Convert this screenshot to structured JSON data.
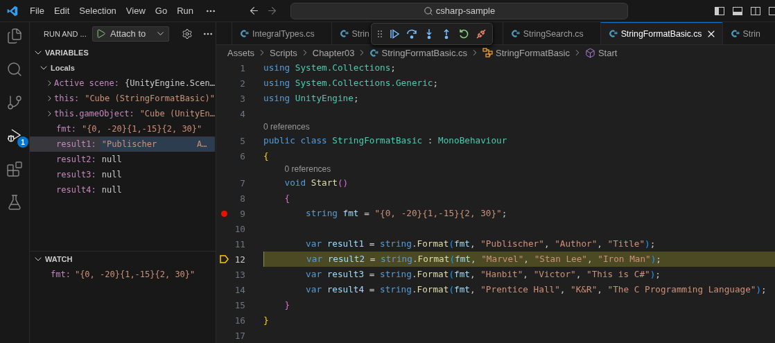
{
  "title_bar": {
    "menus": [
      "File",
      "Edit",
      "Selection",
      "View",
      "Go",
      "Run"
    ],
    "search": "csharp-sample"
  },
  "activity_bar": [
    {
      "kind": "explorer",
      "selected": false
    },
    {
      "kind": "search",
      "selected": false
    },
    {
      "kind": "source_control",
      "selected": false
    },
    {
      "kind": "debug",
      "selected": true,
      "badge": "1"
    },
    {
      "kind": "extensions",
      "selected": false
    },
    {
      "kind": "testing",
      "selected": false
    }
  ],
  "sidebar": {
    "title": "RUN AND ...",
    "launch_config": "Attach to",
    "variables": {
      "title": "VARIABLES",
      "expanded": true,
      "scopes": [
        {
          "label": "Locals",
          "expanded": true,
          "items": [
            {
              "kind": "object",
              "name": "Active scene:",
              "value": "{UnityEngine.Scen…",
              "expanded": false,
              "selected": false
            },
            {
              "kind": "string",
              "name": "this:",
              "value": "\"Cube (StringFormatBasic)\"",
              "expanded": false,
              "selected": false
            },
            {
              "kind": "string",
              "name": "this.gameObject:",
              "value": "\"Cube (UnityEn…",
              "expanded": false,
              "selected": false
            },
            {
              "kind": "string",
              "name": "fmt:",
              "value": "\"{0, -20}{1,-15}{2, 30}\"",
              "selected": false
            },
            {
              "kind": "string",
              "name": "result1:",
              "value": "\"Publischer        A…",
              "selected": true
            },
            {
              "kind": "null",
              "name": "result2:",
              "value": "null",
              "selected": false
            },
            {
              "kind": "null",
              "name": "result3:",
              "value": "null",
              "selected": false
            },
            {
              "kind": "null",
              "name": "result4:",
              "value": "null",
              "selected": false
            }
          ]
        }
      ]
    },
    "watch": {
      "title": "WATCH",
      "expanded": true,
      "items": [
        {
          "kind": "string",
          "name": "fmt:",
          "value": "\"{0, -20}{1,-15}{2, 30}\""
        }
      ]
    }
  },
  "tabs": [
    {
      "label": "IntegralTypes.cs",
      "selected": false
    },
    {
      "label": "Strin",
      "selected": false
    },
    {
      "label": "StringSearch.cs",
      "selected": false
    },
    {
      "label": "StringFormatBasic.cs",
      "selected": true
    },
    {
      "label": "Strin",
      "selected": false
    }
  ],
  "breadcrumb": [
    {
      "kind": "folder",
      "label": "Assets"
    },
    {
      "kind": "folder",
      "label": "Scripts"
    },
    {
      "kind": "folder",
      "label": "Chapter03"
    },
    {
      "kind": "file",
      "label": "StringFormatBasic.cs"
    },
    {
      "kind": "class",
      "label": "StringFormatBasic"
    },
    {
      "kind": "method",
      "label": "Start"
    }
  ],
  "editor": {
    "rows": [
      {
        "kind": "line",
        "number": "1",
        "breakpoint": false,
        "current": false,
        "tokens": [
          {
            "kind": "kw",
            "text": "using"
          },
          {
            "kind": "ns",
            "text": " System.Collections"
          },
          {
            "kind": "p",
            "text": ";"
          }
        ]
      },
      {
        "kind": "line",
        "number": "2",
        "breakpoint": false,
        "current": false,
        "tokens": [
          {
            "kind": "kw",
            "text": "using"
          },
          {
            "kind": "ns",
            "text": " System.Collections.Generic"
          },
          {
            "kind": "p",
            "text": ";"
          }
        ]
      },
      {
        "kind": "line",
        "number": "3",
        "breakpoint": false,
        "current": false,
        "tokens": [
          {
            "kind": "kw",
            "text": "using"
          },
          {
            "kind": "ns",
            "text": " UnityEngine"
          },
          {
            "kind": "p",
            "text": ";"
          }
        ]
      },
      {
        "kind": "line",
        "number": "4",
        "breakpoint": false,
        "current": false,
        "tokens": []
      },
      {
        "kind": "codelens",
        "text": "0 references"
      },
      {
        "kind": "line",
        "number": "5",
        "breakpoint": false,
        "current": false,
        "tokens": [
          {
            "kind": "kw",
            "text": "public class"
          },
          {
            "kind": "type",
            "text": " StringFormatBasic"
          },
          {
            "kind": "p",
            "text": " :"
          },
          {
            "kind": "type",
            "text": " MonoBehaviour"
          }
        ]
      },
      {
        "kind": "line",
        "number": "6",
        "breakpoint": false,
        "current": false,
        "tokens": [
          {
            "kind": "b1",
            "text": "{"
          }
        ]
      },
      {
        "kind": "codelens",
        "text": "0 references"
      },
      {
        "kind": "line",
        "number": "7",
        "breakpoint": false,
        "current": false,
        "tokens": [
          {
            "kind": "kw",
            "text": "    void"
          },
          {
            "kind": "fn",
            "text": " Start"
          },
          {
            "kind": "b2",
            "text": "()"
          }
        ]
      },
      {
        "kind": "line",
        "number": "8",
        "breakpoint": false,
        "current": false,
        "tokens": [
          {
            "kind": "b2",
            "text": "    {"
          }
        ]
      },
      {
        "kind": "line",
        "number": "9",
        "breakpoint": true,
        "current": false,
        "tokens": [
          {
            "kind": "kw",
            "text": "        string"
          },
          {
            "kind": "var",
            "text": " fmt"
          },
          {
            "kind": "p",
            "text": " = "
          },
          {
            "kind": "str",
            "text": "\"{0, -20}{1,-15}{2, 30}\""
          },
          {
            "kind": "p",
            "text": ";"
          }
        ]
      },
      {
        "kind": "line",
        "number": "10",
        "breakpoint": false,
        "current": false,
        "tokens": []
      },
      {
        "kind": "line",
        "number": "11",
        "breakpoint": false,
        "current": false,
        "tokens": [
          {
            "kind": "kw",
            "text": "        var"
          },
          {
            "kind": "var",
            "text": " result1"
          },
          {
            "kind": "p",
            "text": " = "
          },
          {
            "kind": "kw",
            "text": "string"
          },
          {
            "kind": "p",
            "text": "."
          },
          {
            "kind": "fn",
            "text": "Format"
          },
          {
            "kind": "b3",
            "text": "("
          },
          {
            "kind": "var",
            "text": "fmt"
          },
          {
            "kind": "p",
            "text": ", "
          },
          {
            "kind": "str",
            "text": "\"Publischer\""
          },
          {
            "kind": "p",
            "text": ", "
          },
          {
            "kind": "str",
            "text": "\"Author\""
          },
          {
            "kind": "p",
            "text": ", "
          },
          {
            "kind": "str",
            "text": "\"Title\""
          },
          {
            "kind": "b3",
            "text": ")"
          },
          {
            "kind": "p",
            "text": ";"
          }
        ]
      },
      {
        "kind": "line",
        "number": "12",
        "breakpoint": false,
        "current": true,
        "tokens": [
          {
            "kind": "kw",
            "text": "        var"
          },
          {
            "kind": "var",
            "text": " result2"
          },
          {
            "kind": "p",
            "text": " = "
          },
          {
            "kind": "kw",
            "text": "string"
          },
          {
            "kind": "p",
            "text": "."
          },
          {
            "kind": "fn",
            "text": "Format"
          },
          {
            "kind": "b3",
            "text": "("
          },
          {
            "kind": "var",
            "text": "fmt"
          },
          {
            "kind": "p",
            "text": ", "
          },
          {
            "kind": "str",
            "text": "\"Marvel\""
          },
          {
            "kind": "p",
            "text": ", "
          },
          {
            "kind": "str",
            "text": "\"Stan Lee\""
          },
          {
            "kind": "p",
            "text": ", "
          },
          {
            "kind": "str",
            "text": "\"Iron Man\""
          },
          {
            "kind": "b3",
            "text": ")"
          },
          {
            "kind": "p",
            "text": ";"
          }
        ]
      },
      {
        "kind": "line",
        "number": "13",
        "breakpoint": false,
        "current": false,
        "tokens": [
          {
            "kind": "kw",
            "text": "        var"
          },
          {
            "kind": "var",
            "text": " result3"
          },
          {
            "kind": "p",
            "text": " = "
          },
          {
            "kind": "kw",
            "text": "string"
          },
          {
            "kind": "p",
            "text": "."
          },
          {
            "kind": "fn",
            "text": "Format"
          },
          {
            "kind": "b3",
            "text": "("
          },
          {
            "kind": "var",
            "text": "fmt"
          },
          {
            "kind": "p",
            "text": ", "
          },
          {
            "kind": "str",
            "text": "\"Hanbit\""
          },
          {
            "kind": "p",
            "text": ", "
          },
          {
            "kind": "str",
            "text": "\"Victor\""
          },
          {
            "kind": "p",
            "text": ", "
          },
          {
            "kind": "str",
            "text": "\"This is C#\""
          },
          {
            "kind": "b3",
            "text": ")"
          },
          {
            "kind": "p",
            "text": ";"
          }
        ]
      },
      {
        "kind": "line",
        "number": "14",
        "breakpoint": false,
        "current": false,
        "tokens": [
          {
            "kind": "kw",
            "text": "        var"
          },
          {
            "kind": "var",
            "text": " result4"
          },
          {
            "kind": "p",
            "text": " = "
          },
          {
            "kind": "kw",
            "text": "string"
          },
          {
            "kind": "p",
            "text": "."
          },
          {
            "kind": "fn",
            "text": "Format"
          },
          {
            "kind": "b3",
            "text": "("
          },
          {
            "kind": "var",
            "text": "fmt"
          },
          {
            "kind": "p",
            "text": ", "
          },
          {
            "kind": "str",
            "text": "\"Prentice Hall\""
          },
          {
            "kind": "p",
            "text": ", "
          },
          {
            "kind": "str",
            "text": "\"K&R\""
          },
          {
            "kind": "p",
            "text": ", "
          },
          {
            "kind": "str",
            "text": "\"The C Programming Language\""
          },
          {
            "kind": "b3",
            "text": ")"
          },
          {
            "kind": "p",
            "text": ";"
          }
        ]
      },
      {
        "kind": "line",
        "number": "15",
        "breakpoint": false,
        "current": false,
        "tokens": [
          {
            "kind": "b2",
            "text": "    }"
          }
        ]
      },
      {
        "kind": "line",
        "number": "16",
        "breakpoint": false,
        "current": false,
        "tokens": [
          {
            "kind": "b1",
            "text": "}"
          }
        ]
      },
      {
        "kind": "line",
        "number": "17",
        "breakpoint": false,
        "current": false,
        "tokens": []
      }
    ]
  }
}
